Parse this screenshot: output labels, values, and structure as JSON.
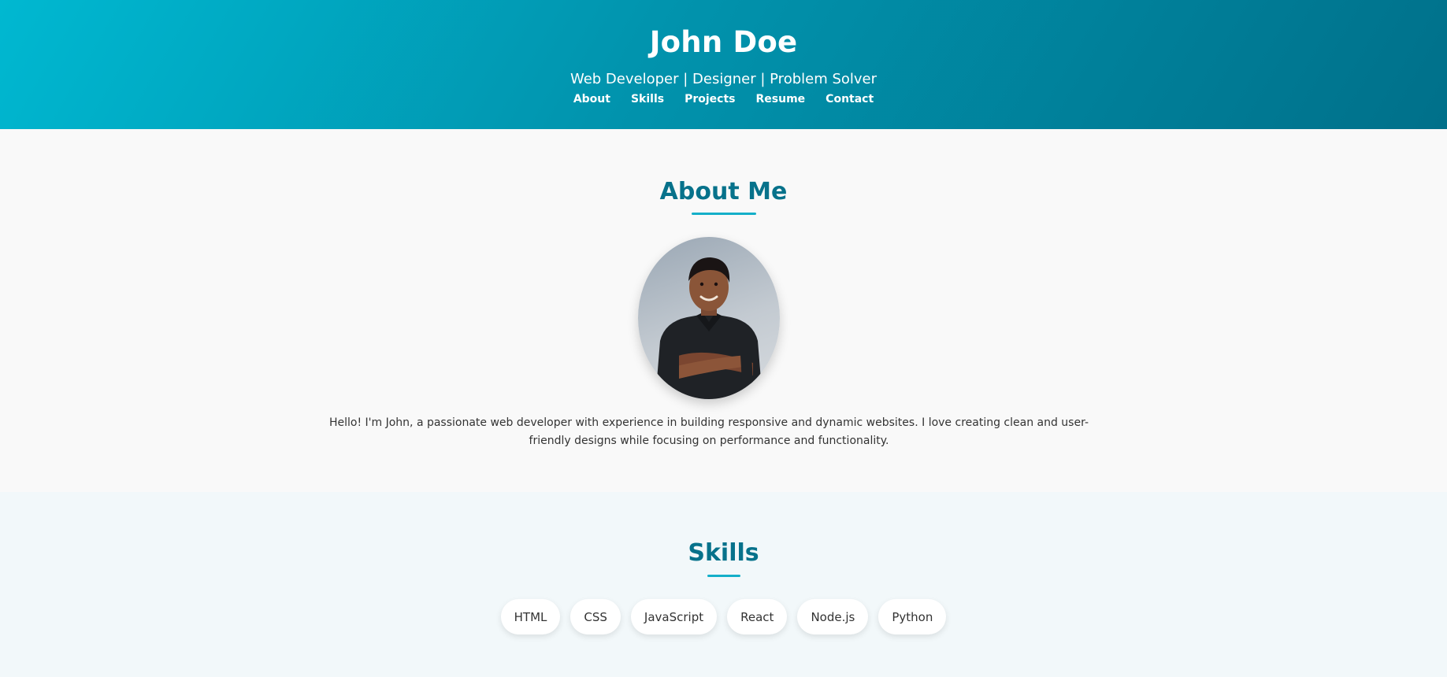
{
  "header": {
    "name": "John Doe",
    "tagline": "Web Developer | Designer | Problem Solver",
    "nav": [
      {
        "label": "About"
      },
      {
        "label": "Skills"
      },
      {
        "label": "Projects"
      },
      {
        "label": "Resume"
      },
      {
        "label": "Contact"
      }
    ]
  },
  "about": {
    "title": "About Me",
    "text": "Hello! I'm John, a passionate web developer with experience in building responsive and dynamic websites. I love creating clean and user-friendly designs while focusing on performance and functionality."
  },
  "skills": {
    "title": "Skills",
    "items": [
      "HTML",
      "CSS",
      "JavaScript",
      "React",
      "Node.js",
      "Python"
    ]
  },
  "colors": {
    "header_gradient_start": "#00b8d1",
    "header_gradient_end": "#00708a",
    "heading": "#07728b",
    "accent": "#14afc9"
  }
}
